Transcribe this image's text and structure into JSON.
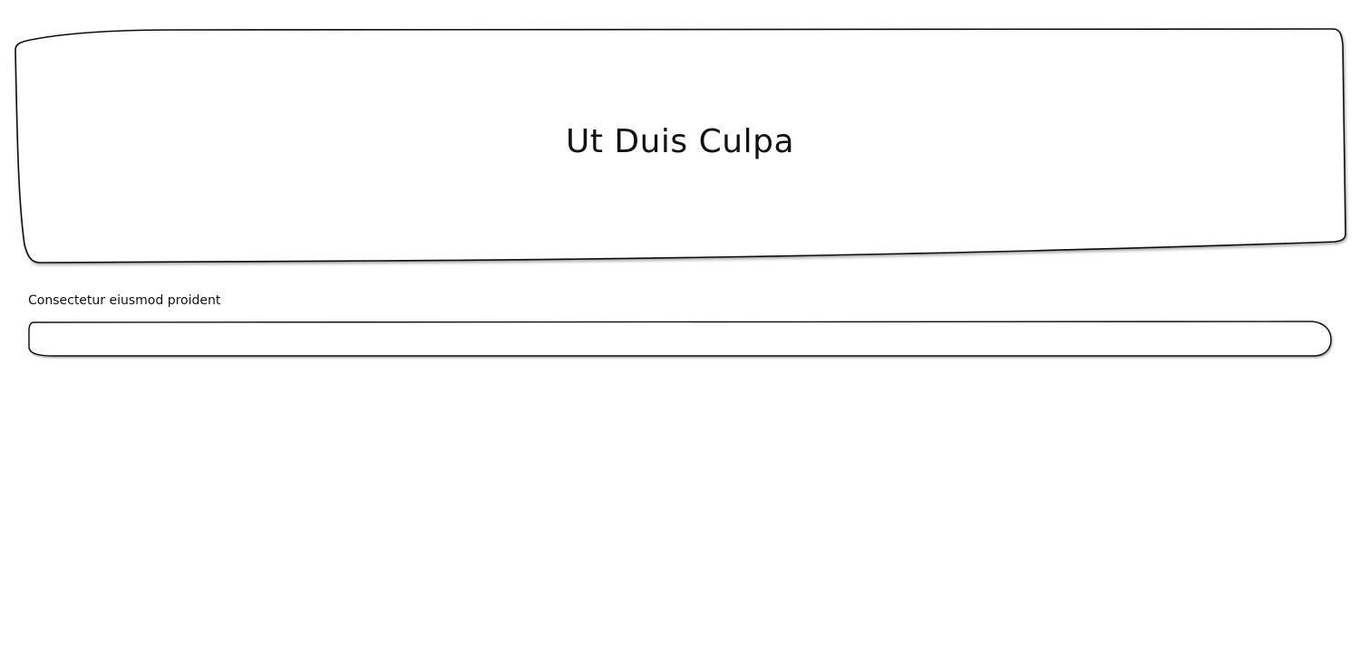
{
  "header": {
    "title": "Ut Duis Culpa"
  },
  "form": {
    "field_label": "Consectetur eiusmod proident",
    "field_value": "",
    "field_placeholder": ""
  },
  "colors": {
    "background": "#ffffff",
    "outline": "#111111",
    "text": "#111111"
  }
}
